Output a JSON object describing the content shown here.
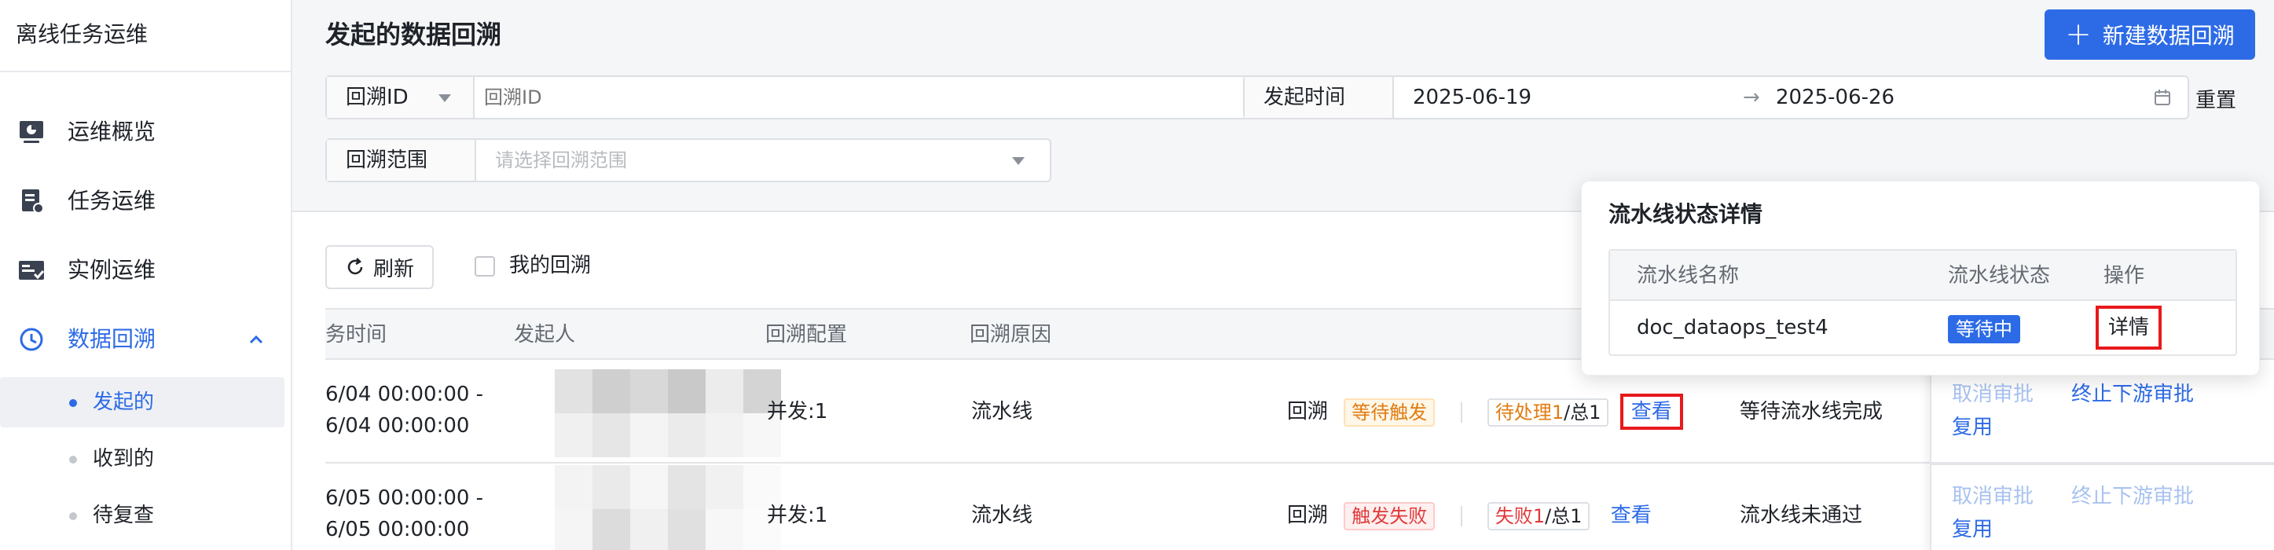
{
  "app": {
    "title": "离线任务运维"
  },
  "sidebar": {
    "items": [
      {
        "label": "运维概览",
        "icon": "dashboard-icon"
      },
      {
        "label": "任务运维",
        "icon": "task-icon"
      },
      {
        "label": "实例运维",
        "icon": "instance-icon"
      },
      {
        "label": "数据回溯",
        "icon": "clock-icon",
        "active": true,
        "expanded": true
      }
    ],
    "sub_items": [
      {
        "label": "发起的",
        "active": true
      },
      {
        "label": "收到的"
      },
      {
        "label": "待复查"
      }
    ]
  },
  "header": {
    "title": "发起的数据回溯",
    "new_button_label": "新建数据回溯"
  },
  "filters": {
    "id_filter": {
      "label": "回溯ID",
      "placeholder": "回溯ID"
    },
    "time_filter": {
      "label": "发起时间",
      "start": "2025-06-19",
      "arrow": "→",
      "end": "2025-06-26"
    },
    "reset_label": "重置",
    "range_filter": {
      "label": "回溯范围",
      "placeholder": "请选择回溯范围"
    }
  },
  "toolbar": {
    "refresh_label": "刷新",
    "mine_label": "我的回溯"
  },
  "table": {
    "columns": [
      "务时间",
      "发起人",
      "回溯配置",
      "回溯原因",
      "操作"
    ],
    "rows": [
      {
        "time_start": "6/04 00:00:00 -",
        "time_end": "6/04 00:00:00",
        "config": "并发:1",
        "reason": "流水线",
        "trigger_prefix": "回溯",
        "trigger_tag": "等待触发",
        "progress_label": "待处理",
        "progress_count": "1",
        "progress_total": "/总1",
        "view_label": "查看",
        "status_text": "等待流水线完成",
        "op_cancel": "取消审批",
        "op_stop": "终止下游审批",
        "op_copy": "复用"
      },
      {
        "time_start": "6/05 00:00:00 -",
        "time_end": "6/05 00:00:00",
        "config": "并发:1",
        "reason": "流水线",
        "trigger_prefix": "回溯",
        "trigger_tag": "触发失败",
        "progress_label": "失败",
        "progress_count": "1",
        "progress_total": "/总1",
        "view_label": "查看",
        "status_text": "流水线未通过",
        "op_cancel": "取消审批",
        "op_stop": "终止下游审批",
        "op_copy": "复用"
      }
    ]
  },
  "popover": {
    "title": "流水线状态详情",
    "columns": [
      "流水线名称",
      "流水线状态",
      "操作"
    ],
    "row": {
      "name": "doc_dataops_test4",
      "status": "等待中",
      "action": "详情"
    }
  },
  "colors": {
    "primary": "#2d6be6",
    "warning": "#e07c12",
    "danger": "#e03a3a",
    "highlight_box": "#e8191c"
  }
}
